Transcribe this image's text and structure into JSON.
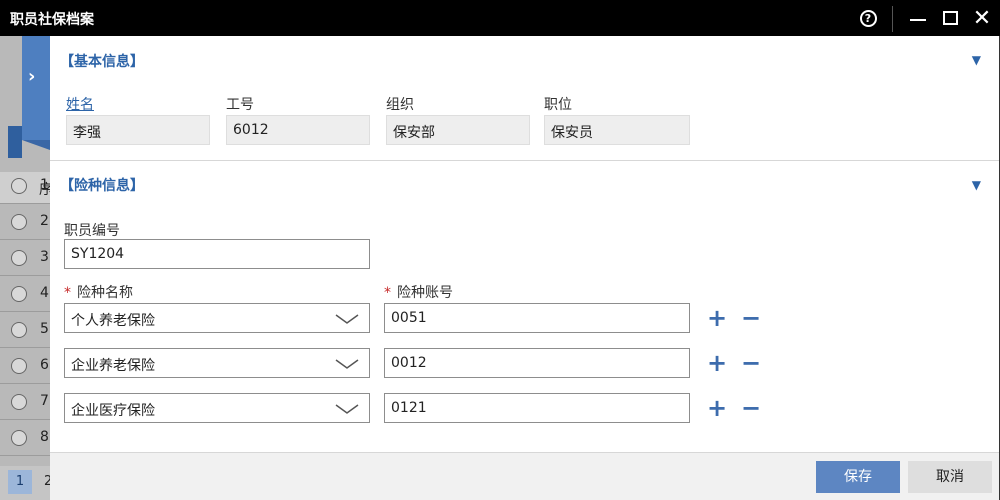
{
  "window": {
    "title": "职员社保档案"
  },
  "background": {
    "header_label": "序",
    "rows": [
      "1",
      "2",
      "3",
      "4",
      "5",
      "6",
      "7",
      "8"
    ],
    "pager": {
      "current": "1",
      "next": "2"
    }
  },
  "basic": {
    "title": "【基本信息】",
    "fields": {
      "name_label": "姓名",
      "name_value": "李强",
      "id_label": "工号",
      "id_value": "6012",
      "org_label": "组织",
      "org_value": "保安部",
      "position_label": "职位",
      "position_value": "保安员"
    }
  },
  "insurance": {
    "title": "【险种信息】",
    "employee_no_label": "职员编号",
    "employee_no_value": "SY1204",
    "type_label": "险种名称",
    "account_label": "险种账号",
    "required_mark": "*",
    "rows": [
      {
        "type": "个人养老保险",
        "account": "0051"
      },
      {
        "type": "企业养老保险",
        "account": "0012"
      },
      {
        "type": "企业医疗保险",
        "account": "0121"
      }
    ],
    "add_symbol": "+",
    "remove_symbol": "−"
  },
  "footer": {
    "save_label": "保存",
    "cancel_label": "取消"
  },
  "colors": {
    "accent": "#2d64a8",
    "primary_button": "#5d86c2",
    "titlebar": "#000000"
  }
}
